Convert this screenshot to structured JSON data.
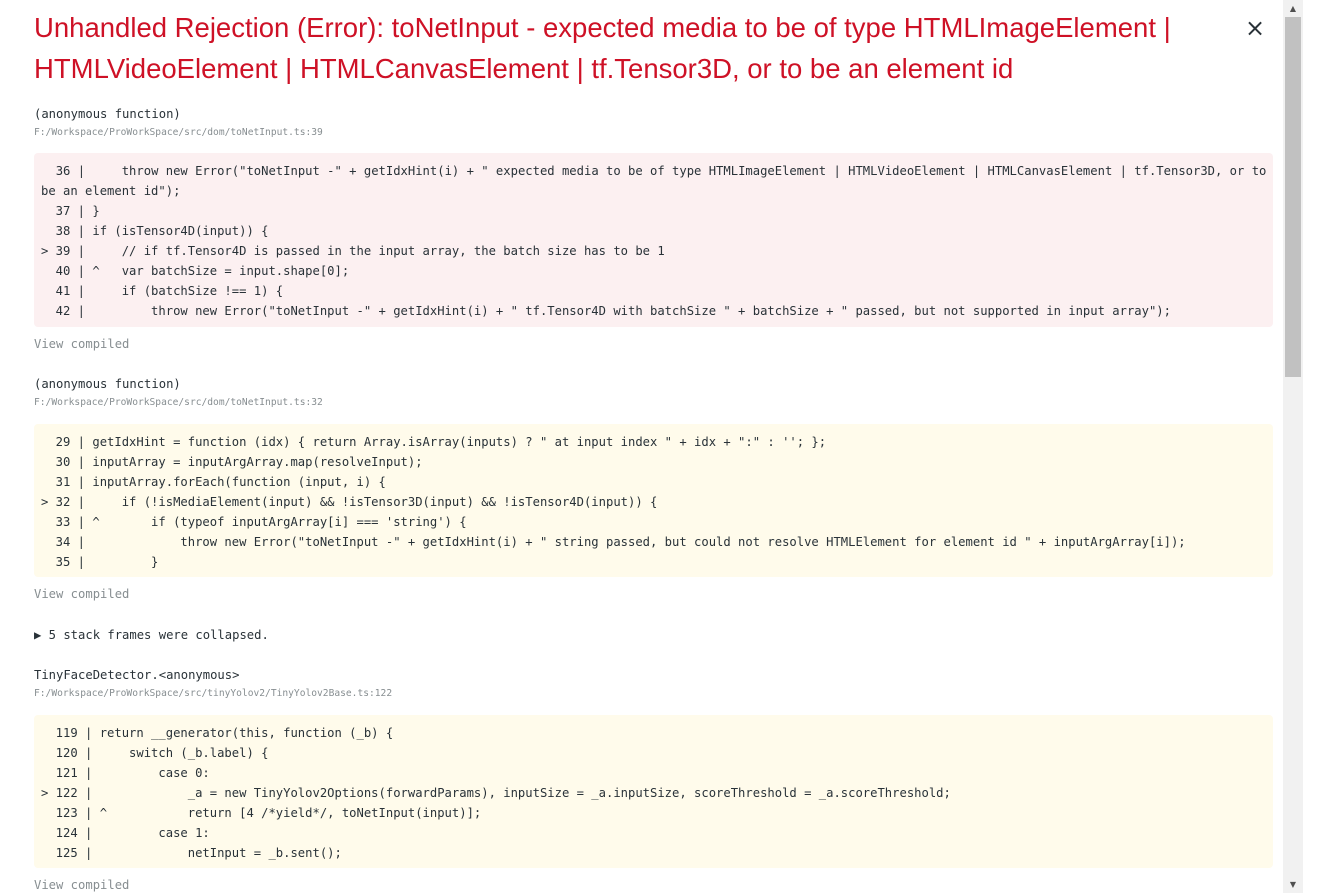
{
  "error": {
    "title": "Unhandled Rejection (Error): toNetInput - expected media to be of type HTMLImageElement | HTMLVideoElement | HTMLCanvasElement | tf.Tensor3D, or to be an element id",
    "close_glyph": "×"
  },
  "frames": [
    {
      "function": "(anonymous function)",
      "file": "F:/Workspace/ProWorkSpace/src/dom/toNetInput.ts:39",
      "lines": [
        "  36 |     throw new Error(\"toNetInput -\" + getIdxHint(i) + \" expected media to be of type HTMLImageElement | HTMLVideoElement | HTMLCanvasElement | tf.Tensor3D, or to be an element id\");",
        "  37 | }",
        "  38 | if (isTensor4D(input)) {",
        "> 39 |     // if tf.Tensor4D is passed in the input array, the batch size has to be 1",
        "  40 | ^   var batchSize = input.shape[0];",
        "  41 |     if (batchSize !== 1) {",
        "  42 |         throw new Error(\"toNetInput -\" + getIdxHint(i) + \" tf.Tensor4D with batchSize \" + batchSize + \" passed, but not supported in input array\");"
      ],
      "view_compiled": "View compiled"
    },
    {
      "function": "(anonymous function)",
      "file": "F:/Workspace/ProWorkSpace/src/dom/toNetInput.ts:32",
      "lines": [
        "  29 | getIdxHint = function (idx) { return Array.isArray(inputs) ? \" at input index \" + idx + \":\" : ''; };",
        "  30 | inputArray = inputArgArray.map(resolveInput);",
        "  31 | inputArray.forEach(function (input, i) {",
        "> 32 |     if (!isMediaElement(input) && !isTensor3D(input) && !isTensor4D(input)) {",
        "  33 | ^       if (typeof inputArgArray[i] === 'string') {",
        "  34 |             throw new Error(\"toNetInput -\" + getIdxHint(i) + \" string passed, but could not resolve HTMLElement for element id \" + inputArgArray[i]);",
        "  35 |         }"
      ],
      "view_compiled": "View compiled"
    },
    {
      "function": "TinyFaceDetector.<anonymous>",
      "file": "F:/Workspace/ProWorkSpace/src/tinyYolov2/TinyYolov2Base.ts:122",
      "lines": [
        "  119 | return __generator(this, function (_b) {",
        "  120 |     switch (_b.label) {",
        "  121 |         case 0:",
        "> 122 |             _a = new TinyYolov2Options(forwardParams), inputSize = _a.inputSize, scoreThreshold = _a.scoreThreshold;",
        "  123 | ^           return [4 /*yield*/, toNetInput(input)];",
        "  124 |         case 1:",
        "  125 |             netInput = _b.sent();"
      ],
      "view_compiled": "View compiled"
    }
  ],
  "collapsed": "▶ 5 stack frames were collapsed.",
  "scrollbar": {
    "up_icon": "▲",
    "down_icon": "▼"
  },
  "colors": {
    "title": "#ce1126",
    "code_bg_error": "#fcf0f1",
    "code_bg_context": "#fffbeb",
    "muted": "#878e91"
  }
}
